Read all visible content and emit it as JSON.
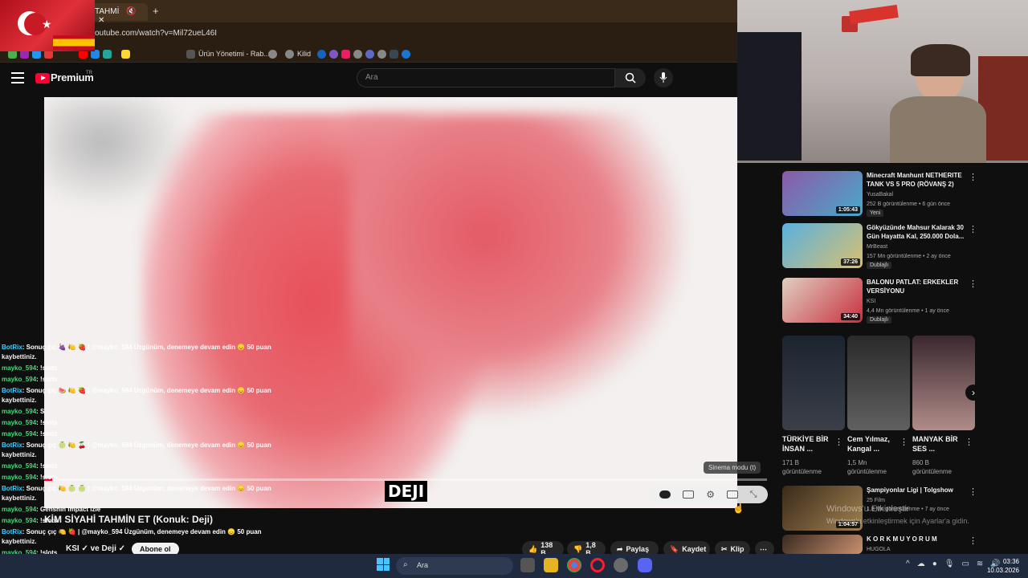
{
  "browser": {
    "tab_title": "TAHMİ",
    "url": "outube.com/watch?v=Mil72ueL46I",
    "bookmarks": [
      "Ürün Yönetimi - Rab...",
      "Kilid"
    ]
  },
  "youtube": {
    "logo_text": "Premium",
    "logo_sup": "TR",
    "search_placeholder": "Ara"
  },
  "video": {
    "caption": "DEJI",
    "sinema_tooltip": "Sinema modu (t)",
    "title": "KİM SİYAHİ TAHMİN ET (Konuk: Deji)",
    "channel": "KSI ✓ ve Deji ✓",
    "subscribe": "Abone ol",
    "likes": "138 B",
    "dislikes": "1,8 B",
    "share": "Paylaş",
    "save": "Kaydet",
    "clip": "Klip"
  },
  "chat": [
    {
      "user": "BotRix",
      "kind": "bot",
      "text": ": Sonuç çıç 🍇 🍋 🍓 | @mayko_594 Üzgünüm, denemeye devam edin 😞 50 puan",
      "cont": "kaybettiniz."
    },
    {
      "user": "mayko_594",
      "kind": "may",
      "text": ": !slots"
    },
    {
      "user": "mayko_594",
      "kind": "may",
      "text": ": !slots"
    },
    {
      "user": "BotRix",
      "kind": "bot",
      "text": ": Sonuç çıç 🍉 🍋 🍓 | @mayko_594 Üzgünüm, denemeye devam edin 😞 50 puan",
      "cont": "kaybettiniz."
    },
    {
      "user": "mayko_594",
      "kind": "may",
      "text": ": S"
    },
    {
      "user": "mayko_594",
      "kind": "may",
      "text": ": !slots"
    },
    {
      "user": "mayko_594",
      "kind": "may",
      "text": ": !slots"
    },
    {
      "user": "BotRix",
      "kind": "bot",
      "text": ": Sonuç çıç 🍈 🍋 🍒 | @mayko_594 Üzgünüm, denemeye devam edin 😞 50 puan",
      "cont": "kaybettiniz."
    },
    {
      "user": "mayko_594",
      "kind": "may",
      "text": ": !slots"
    },
    {
      "user": "mayko_594",
      "kind": "may",
      "text": ": !slots"
    },
    {
      "user": "BotRix",
      "kind": "bot",
      "text": ": Sonuç çıç 🍋 🍈 🍈 | @mayko_594 Üzgünüm, denemeye devam edin 😞 50 puan",
      "cont": "kaybettiniz."
    },
    {
      "user": "mayko_594",
      "kind": "may",
      "text": ": Genshin impact izle"
    },
    {
      "user": "mayko_594",
      "kind": "may",
      "text": ": !slots"
    },
    {
      "user": "BotRix",
      "kind": "bot",
      "text": ": Sonuç çıç 🍋 🍓 | @mayko_594 Üzgünüm, denemeye devam edin 😞 50 puan",
      "cont": "kaybettiniz."
    },
    {
      "user": "mayko_594",
      "kind": "may",
      "text": ": !slots"
    }
  ],
  "sidebar": {
    "videos": [
      {
        "title": "Minecraft Manhunt NETHERITE TANK VS 5 PRO (RÖVANŞ 2)",
        "channel": "YusaBakal",
        "meta": "252 B görüntülenme • 6 gün önce",
        "badge": "Yeni",
        "duration": "1:05:43"
      },
      {
        "title": "Gökyüzünde Mahsur Kalarak 30 Gün Hayatta Kal, 250.000 Dola...",
        "channel": "MrBeast",
        "meta": "157 Mn görüntülenme • 2 ay önce",
        "badge": "Dublajlı",
        "duration": "37:26"
      },
      {
        "title": "BALONU PATLAT: ERKEKLER VERSİYONU",
        "channel": "KSI",
        "meta": "4,4 Mn görüntülenme • 1 ay önce",
        "badge": "Dublajlı",
        "duration": "34:40"
      }
    ],
    "shorts": [
      {
        "title": "TÜRKİYE BİR İNSAN ...",
        "views": "171 B görüntülenme"
      },
      {
        "title": "Cem Yılmaz, Kangal ...",
        "views": "1,5 Mn görüntülenme"
      },
      {
        "title": "MANYAK BİR SES ...",
        "views": "860 B görüntülenme"
      }
    ],
    "bottom_videos": [
      {
        "title": "Şampiyonlar Ligi | Tolgshow",
        "channel": "25 Film",
        "meta": "1,8 Mn görüntülenme • 7 ay önce",
        "duration": "1:04:57"
      },
      {
        "title": "K O R K M U Y O R U M",
        "channel": "HUGOLA",
        "meta": ""
      }
    ]
  },
  "windows_watermark": {
    "line1": "Windows'u Etkinleştir",
    "line2": "Windows'u etkinleştirmek için Ayarlar'a gidin."
  },
  "taskbar": {
    "search": "Ara",
    "time": "03:36",
    "date": "10.03.2026"
  }
}
